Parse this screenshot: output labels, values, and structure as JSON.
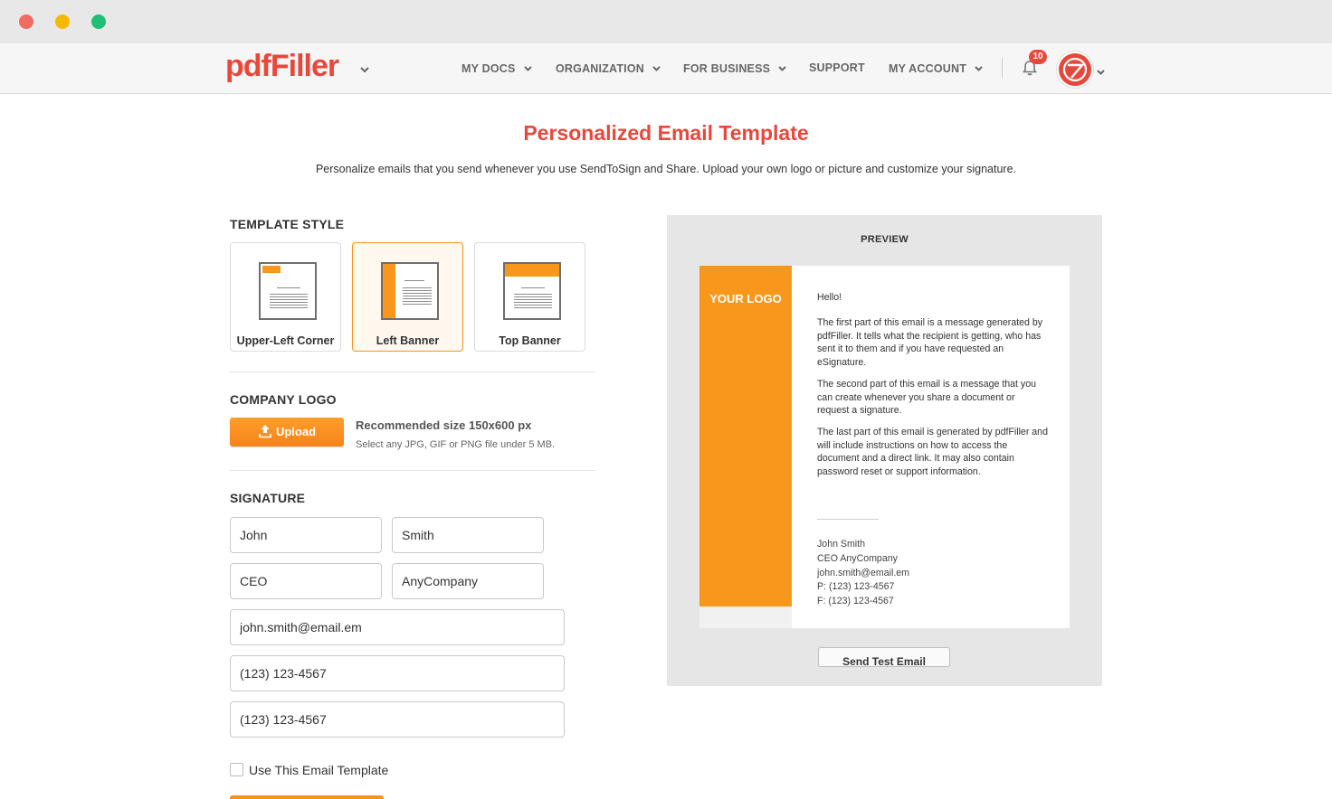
{
  "header": {
    "logo": "pdfFiller",
    "nav": [
      {
        "label": "MY DOCS",
        "has_dropdown": true
      },
      {
        "label": "ORGANIZATION",
        "has_dropdown": true
      },
      {
        "label": "FOR BUSINESS",
        "has_dropdown": true
      },
      {
        "label": "SUPPORT",
        "has_dropdown": false
      },
      {
        "label": "MY ACCOUNT",
        "has_dropdown": true
      }
    ],
    "notifications_count": "10",
    "icons": [
      "chevron-down-icon",
      "bell-icon",
      "avatar"
    ]
  },
  "page": {
    "title": "Personalized Email Template",
    "subtitle": "Personalize emails that you send whenever you use SendToSign and Share. Upload your own logo or picture and customize your signature."
  },
  "template_style": {
    "heading": "TEMPLATE STYLE",
    "options": [
      "Upper-Left Corner",
      "Left Banner",
      "Top Banner"
    ],
    "selected": "Left Banner"
  },
  "company_logo": {
    "heading": "COMPANY LOGO",
    "upload_label": "Upload",
    "recommended": "Recommended size 150x600 px",
    "note": "Select any JPG, GIF or PNG file under 5 MB."
  },
  "signature": {
    "heading": "SIGNATURE",
    "first_name": "John",
    "last_name": "Smith",
    "title": "CEO",
    "company": "AnyCompany",
    "email": "john.smith@email.em",
    "phone": "(123) 123-4567",
    "fax": "(123) 123-4567",
    "use_template_label": "Use This Email Template",
    "use_template_checked": false
  },
  "preview": {
    "heading": "PREVIEW",
    "logo_placeholder": "YOUR LOGO",
    "greeting": "Hello!",
    "para1": "The first part of this email is a message generated by pdfFiller. It tells what the recipient is getting, who has sent it to them and if you have requested an eSignature.",
    "para2": "The second part of this email is a message that you can create whenever you share a document or request a signature.",
    "para3": "The last part of this email is generated by pdfFiller and will include instructions on how to access the document and a direct link. It may also contain password reset or support information.",
    "sig_name": "John Smith",
    "sig_title": "CEO AnyCompany",
    "sig_email": "john.smith@email.em",
    "sig_phone": "P: (123) 123-4567",
    "sig_fax": "F: (123) 123-4567",
    "send_test_label": "Send Test Email"
  },
  "colors": {
    "brand_red": "#e8483b",
    "accent_orange": "#f7981d"
  }
}
